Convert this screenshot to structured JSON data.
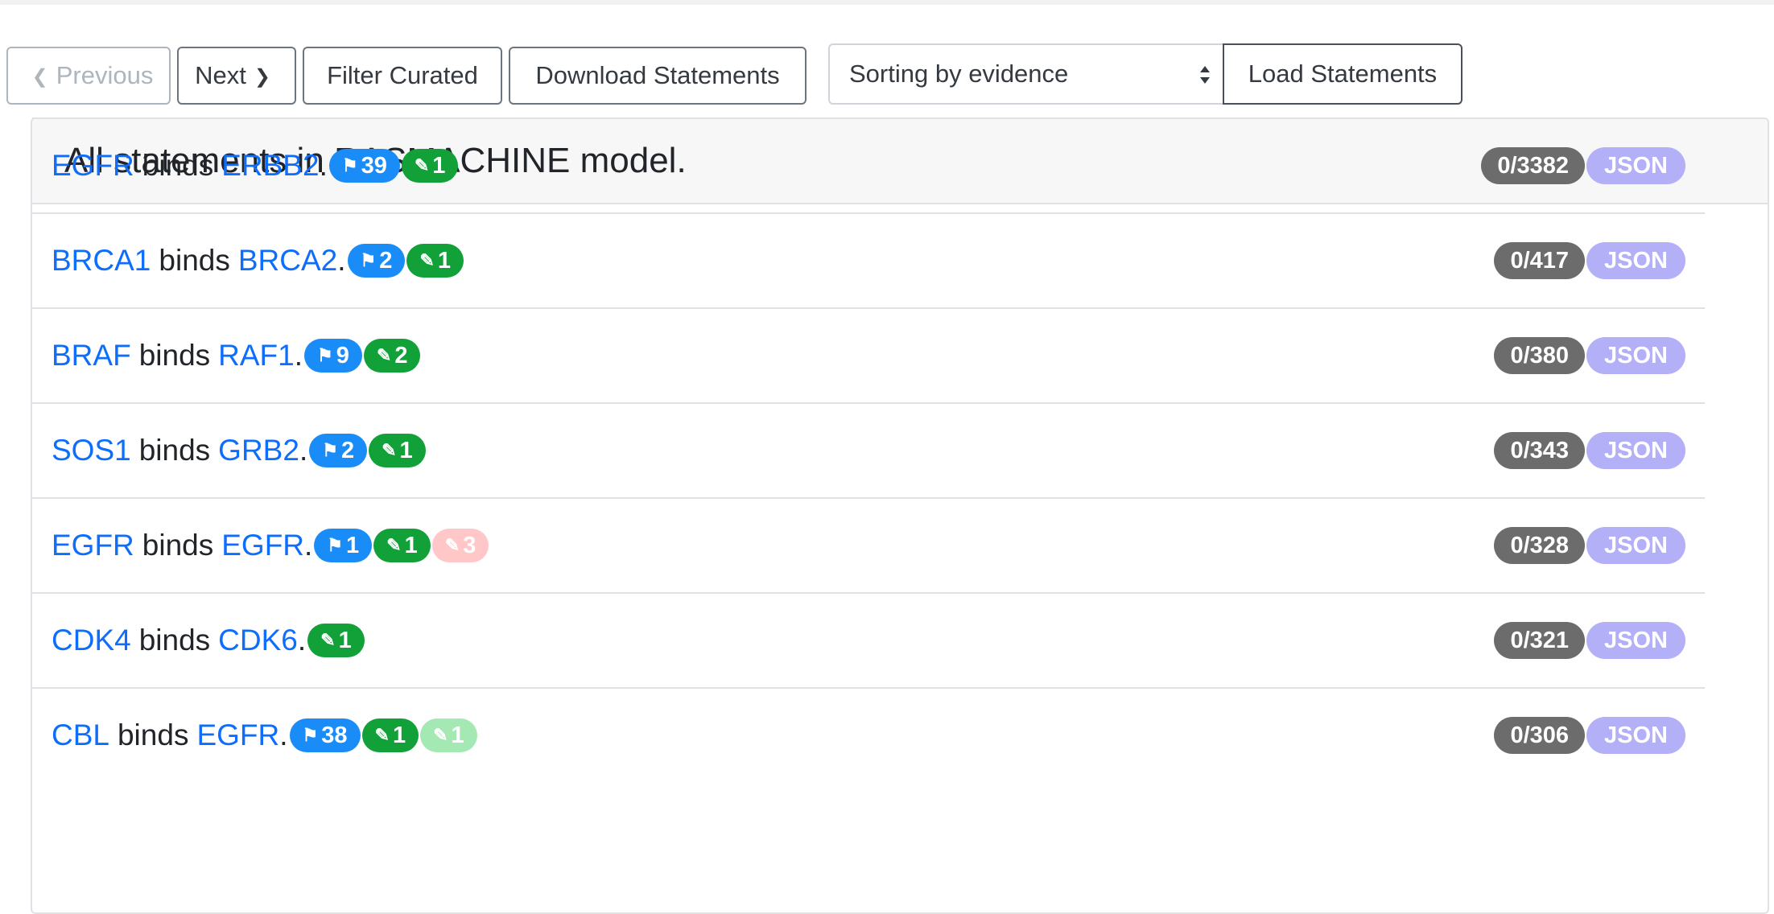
{
  "toolbar": {
    "previous_label": "Previous",
    "next_label": "Next",
    "filter_label": "Filter Curated",
    "download_label": "Download Statements",
    "sort_value": "Sorting by evidence",
    "load_label": "Load Statements"
  },
  "card": {
    "title": "All statements in RASMACHINE model."
  },
  "statements": [
    {
      "subject": "EGFR",
      "verb": "binds",
      "object": "ERBB2",
      "dot": ".",
      "badges": [
        {
          "icon": "flag-icon",
          "glyph": "⚑",
          "text": "39",
          "color": "blue"
        },
        {
          "icon": "pencil-icon",
          "glyph": "✎",
          "text": "1",
          "color": "green"
        }
      ],
      "count": "0/3382",
      "json": "JSON"
    },
    {
      "subject": "BRCA1",
      "verb": "binds",
      "object": "BRCA2",
      "dot": ".",
      "badges": [
        {
          "icon": "flag-icon",
          "glyph": "⚑",
          "text": "2",
          "color": "blue"
        },
        {
          "icon": "pencil-icon",
          "glyph": "✎",
          "text": "1",
          "color": "green"
        }
      ],
      "count": "0/417",
      "json": "JSON"
    },
    {
      "subject": "BRAF",
      "verb": "binds",
      "object": "RAF1",
      "dot": ".",
      "badges": [
        {
          "icon": "flag-icon",
          "glyph": "⚑",
          "text": "9",
          "color": "blue"
        },
        {
          "icon": "pencil-icon",
          "glyph": "✎",
          "text": "2",
          "color": "green"
        }
      ],
      "count": "0/380",
      "json": "JSON"
    },
    {
      "subject": "SOS1",
      "verb": "binds",
      "object": "GRB2",
      "dot": ".",
      "badges": [
        {
          "icon": "flag-icon",
          "glyph": "⚑",
          "text": "2",
          "color": "blue"
        },
        {
          "icon": "pencil-icon",
          "glyph": "✎",
          "text": "1",
          "color": "green"
        }
      ],
      "count": "0/343",
      "json": "JSON"
    },
    {
      "subject": "EGFR",
      "verb": "binds",
      "object": "EGFR",
      "dot": ".",
      "badges": [
        {
          "icon": "flag-icon",
          "glyph": "⚑",
          "text": "1",
          "color": "blue"
        },
        {
          "icon": "pencil-icon",
          "glyph": "✎",
          "text": "1",
          "color": "green"
        },
        {
          "icon": "pencil-icon",
          "glyph": "✎",
          "text": "3",
          "color": "pink"
        }
      ],
      "count": "0/328",
      "json": "JSON"
    },
    {
      "subject": "CDK4",
      "verb": "binds",
      "object": "CDK6",
      "dot": ".",
      "badges": [
        {
          "icon": "pencil-icon",
          "glyph": "✎",
          "text": "1",
          "color": "green"
        }
      ],
      "count": "0/321",
      "json": "JSON"
    },
    {
      "subject": "CBL",
      "verb": "binds",
      "object": "EGFR",
      "dot": ".",
      "badges": [
        {
          "icon": "flag-icon",
          "glyph": "⚑",
          "text": "38",
          "color": "blue"
        },
        {
          "icon": "pencil-icon",
          "glyph": "✎",
          "text": "1",
          "color": "green"
        },
        {
          "icon": "pencil-icon",
          "glyph": "✎",
          "text": "1",
          "color": "lgreen"
        }
      ],
      "count": "0/306",
      "json": "JSON"
    }
  ],
  "colors": {
    "entity": "#0d6efd",
    "flag_badge": "#1a8cf7",
    "curation_badge": "#12a038",
    "count_badge": "#6c6c6c",
    "json_badge": "#b3b0f8"
  }
}
